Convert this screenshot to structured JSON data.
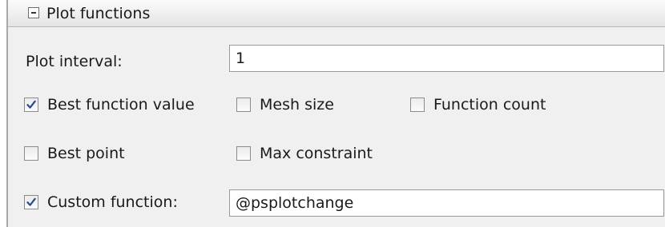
{
  "header": {
    "title": "Plot functions",
    "collapse_icon": "minus-box-icon"
  },
  "plot_interval": {
    "label": "Plot interval:",
    "value": "1"
  },
  "checkboxes": {
    "best_function_value": {
      "label": "Best function value",
      "checked": true
    },
    "mesh_size": {
      "label": "Mesh size",
      "checked": false
    },
    "function_count": {
      "label": "Function count",
      "checked": false
    },
    "best_point": {
      "label": "Best point",
      "checked": false
    },
    "max_constraint": {
      "label": "Max constraint",
      "checked": false
    },
    "custom_function": {
      "label": "Custom function:",
      "checked": true
    }
  },
  "custom_function_field": {
    "value": "@psplotchange"
  },
  "colors": {
    "panel_background": "#f0f0f0",
    "checkmark": "#2a4a8c"
  }
}
